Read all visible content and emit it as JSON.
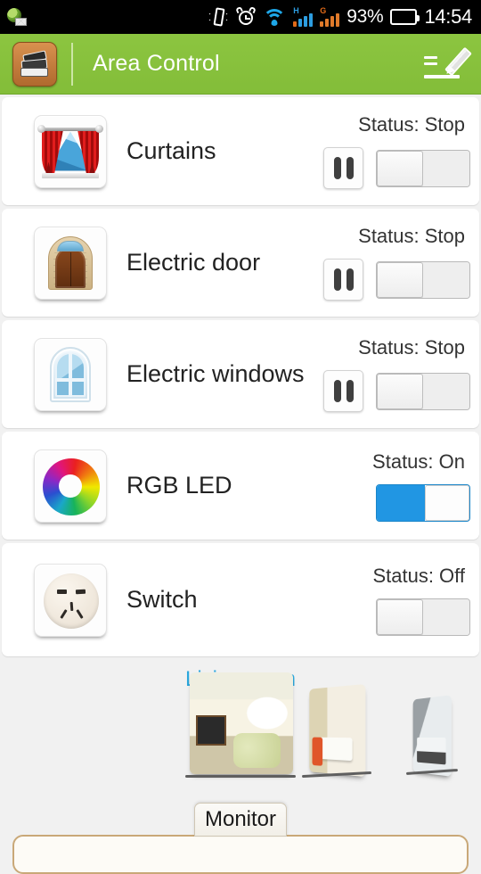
{
  "status_bar": {
    "battery_percent": "93%",
    "time": "14:54",
    "icons": [
      "mail-globe-icon",
      "vibrate-icon",
      "alarm-icon",
      "wifi-icon",
      "signal-h-icon",
      "signal-g-icon",
      "battery-icon"
    ],
    "signal_h_label": "H",
    "signal_g_label": "G"
  },
  "app_bar": {
    "title": "Area Control",
    "app_icon": "books-stack-icon",
    "edit_icon": "pencil-edit-icon"
  },
  "devices": [
    {
      "name": "Curtains",
      "icon": "curtains-icon",
      "status_label": "Status: Stop",
      "has_pause": true,
      "pause_icon": "pause-icon",
      "toggle_state": "off"
    },
    {
      "name": "Electric door",
      "icon": "door-icon",
      "status_label": "Status: Stop",
      "has_pause": true,
      "pause_icon": "pause-icon",
      "toggle_state": "off"
    },
    {
      "name": "Electric windows",
      "icon": "window-icon",
      "status_label": "Status: Stop",
      "has_pause": true,
      "pause_icon": "pause-icon",
      "toggle_state": "off"
    },
    {
      "name": "RGB LED",
      "icon": "color-wheel-icon",
      "status_label": "Status: On",
      "has_pause": false,
      "pause_icon": "",
      "toggle_state": "on"
    },
    {
      "name": "Switch",
      "icon": "power-socket-icon",
      "status_label": "Status: Off",
      "has_pause": false,
      "pause_icon": "",
      "toggle_state": "off"
    }
  ],
  "gallery": {
    "room_label": "Living room",
    "covers": [
      {
        "name": "living-room-photo"
      },
      {
        "name": "dining-room-photo"
      },
      {
        "name": "bedroom-photo"
      }
    ]
  },
  "bottom": {
    "tab_label": "Monitor"
  },
  "colors": {
    "appbar_green": "#8cc540",
    "toggle_on_blue": "#2196e3",
    "room_label_blue": "#2ba7dd"
  }
}
